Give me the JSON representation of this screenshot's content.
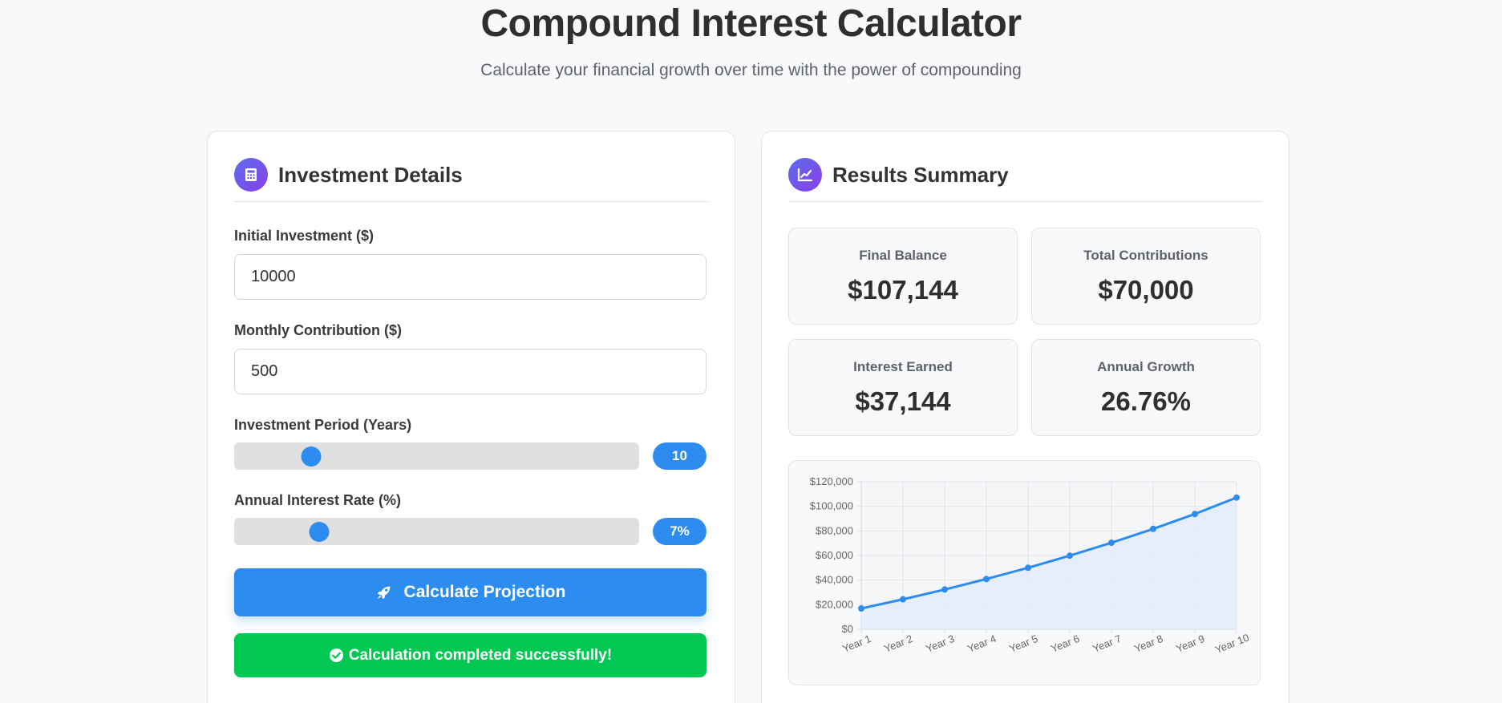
{
  "header": {
    "title": "Compound Interest Calculator",
    "subtitle": "Calculate your financial growth over time with the power of compounding"
  },
  "investment_panel": {
    "title": "Investment Details",
    "icon": "calculator-icon",
    "initial_label": "Initial Investment ($)",
    "initial_value": "10000",
    "monthly_label": "Monthly Contribution ($)",
    "monthly_value": "500",
    "period_label": "Investment Period (Years)",
    "period_value": "10",
    "period_slider_fraction": 0.19,
    "rate_label": "Annual Interest Rate (%)",
    "rate_value": "7%",
    "rate_slider_fraction": 0.21,
    "calculate_label": "Calculate Projection",
    "calculate_icon": "rocket-icon",
    "success_message": "Calculation completed successfully!",
    "success_icon": "check-circle-icon"
  },
  "results_panel": {
    "title": "Results Summary",
    "icon": "chart-line-icon",
    "stats": [
      {
        "label": "Final Balance",
        "value": "$107,144"
      },
      {
        "label": "Total Contributions",
        "value": "$70,000"
      },
      {
        "label": "Interest Earned",
        "value": "$37,144"
      },
      {
        "label": "Annual Growth",
        "value": "26.76%"
      }
    ]
  },
  "colors": {
    "accent": "#2d8cf0",
    "success": "#00c853",
    "icon_gradient_start": "#5b6cf0",
    "icon_gradient_end": "#8a3fe6",
    "area_fill": "#e3edfa"
  },
  "chart_data": {
    "type": "area",
    "categories": [
      "Year 1",
      "Year 2",
      "Year 3",
      "Year 4",
      "Year 5",
      "Year 6",
      "Year 7",
      "Year 8",
      "Year 9",
      "Year 10"
    ],
    "series": [
      {
        "values": [
          16930,
          24360,
          32330,
          40870,
          50030,
          59850,
          70380,
          81670,
          93770,
          107144
        ]
      }
    ],
    "y_ticks": [
      "$0",
      "$20,000",
      "$40,000",
      "$60,000",
      "$80,000",
      "$100,000",
      "$120,000"
    ],
    "ylim": [
      0,
      120000
    ],
    "grid": true,
    "title": "",
    "xlabel": "",
    "ylabel": ""
  }
}
